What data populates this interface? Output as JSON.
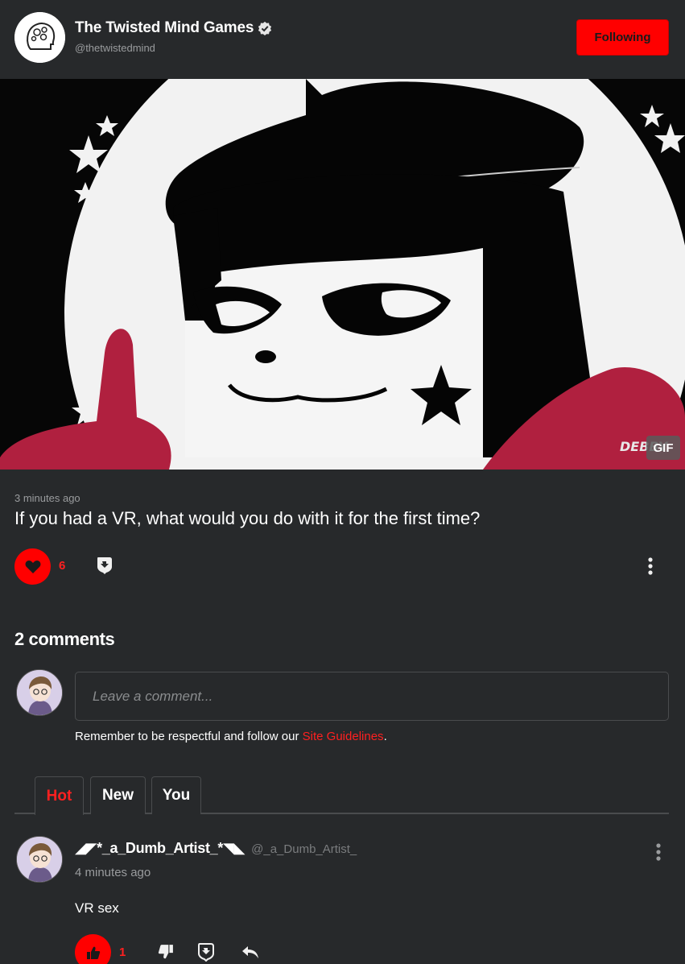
{
  "header": {
    "title": "The Twisted Mind Games",
    "handle": "@thetwistedmind",
    "follow_label": "Following",
    "logo_text": "THE TWISTED MIND GAMES"
  },
  "media": {
    "badge": "GIF",
    "watermark": "DEBBY"
  },
  "post": {
    "timestamp": "3 minutes ago",
    "text": "If you had a VR, what would you do with it for the first time?",
    "like_count": "6"
  },
  "comments_section": {
    "title": "2 comments",
    "input_placeholder": "Leave a comment...",
    "guidelines_prefix": "Remember to be respectful and follow our ",
    "guidelines_link": "Site Guidelines",
    "guidelines_suffix": ".",
    "tabs": [
      {
        "label": "Hot",
        "active": true
      },
      {
        "label": "New",
        "active": false
      },
      {
        "label": "You",
        "active": false
      }
    ]
  },
  "comments": [
    {
      "author": "◢◤*_a_Dumb_Artist_*◥◣",
      "handle": "@_a_Dumb_Artist_",
      "time": "4 minutes ago",
      "text": "VR sex",
      "like_count": "1"
    }
  ],
  "colors": {
    "background": "#27292b",
    "accent": "#ff0000",
    "muted": "#9a9c9e"
  }
}
